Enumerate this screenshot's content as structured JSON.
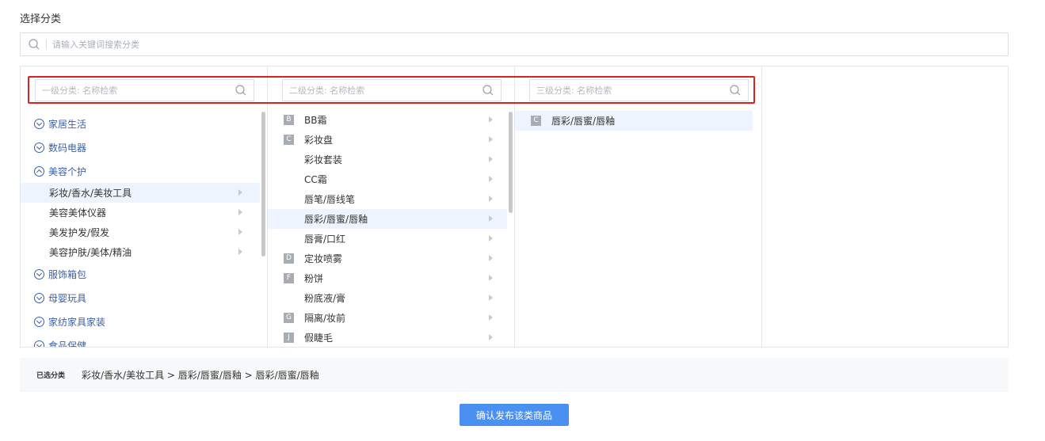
{
  "page": {
    "title": "选择分类"
  },
  "global_search": {
    "placeholder": "请输入关键词搜索分类"
  },
  "level1": {
    "search_placeholder": "一级分类: 名称检索",
    "groups": [
      {
        "label": "家居生活",
        "expanded": false
      },
      {
        "label": "数码电器",
        "expanded": false
      },
      {
        "label": "美容个护",
        "expanded": true,
        "children": [
          "彩妆/香水/美妆工具",
          "美容美体仪器",
          "美发护发/假发",
          "美容护肤/美体/精油"
        ]
      },
      {
        "label": "服饰箱包",
        "expanded": false
      },
      {
        "label": "母婴玩具",
        "expanded": false
      },
      {
        "label": "家纺家具家装",
        "expanded": false
      },
      {
        "label": "食品保健",
        "expanded": false
      }
    ],
    "selected": "彩妆/香水/美妆工具"
  },
  "level2": {
    "search_placeholder": "二级分类: 名称检索",
    "items": [
      {
        "letter": "B",
        "label": "BB霜"
      },
      {
        "letter": "C",
        "label": "彩妆盘"
      },
      {
        "letter": "",
        "label": "彩妆套装"
      },
      {
        "letter": "",
        "label": "CC霜"
      },
      {
        "letter": "",
        "label": "唇笔/唇线笔"
      },
      {
        "letter": "",
        "label": "唇彩/唇蜜/唇釉"
      },
      {
        "letter": "",
        "label": "唇膏/口红"
      },
      {
        "letter": "D",
        "label": "定妆喷雾"
      },
      {
        "letter": "F",
        "label": "粉饼"
      },
      {
        "letter": "",
        "label": "粉底液/膏"
      },
      {
        "letter": "G",
        "label": "隔离/妆前"
      },
      {
        "letter": "J",
        "label": "假睫毛"
      }
    ],
    "selected": "唇彩/唇蜜/唇釉"
  },
  "level3": {
    "search_placeholder": "三级分类: 名称检索",
    "items": [
      {
        "letter": "C",
        "label": "唇彩/唇蜜/唇釉"
      }
    ],
    "selected": "唇彩/唇蜜/唇釉"
  },
  "selected_bar": {
    "label": "已选分类",
    "path": "彩妆/香水/美妆工具 > 唇彩/唇蜜/唇釉 > 唇彩/唇蜜/唇釉"
  },
  "confirm_button": {
    "label": "确认发布该类商品"
  },
  "colors": {
    "accent": "#4a90f0",
    "link": "#3a5fa8",
    "highlight": "#edf4fd",
    "annotation": "#e02020"
  }
}
